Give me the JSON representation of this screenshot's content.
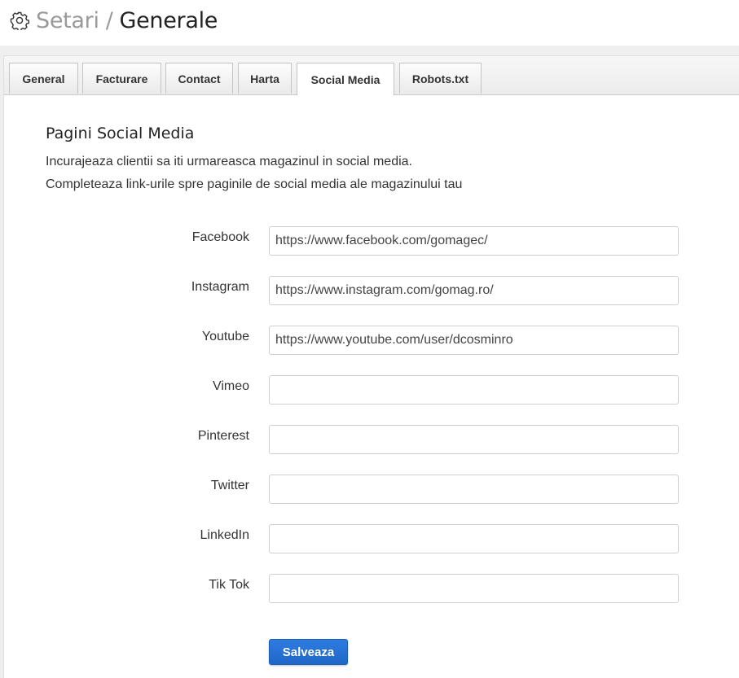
{
  "header": {
    "icon": "gear-icon",
    "breadcrumb_parent": "Setari",
    "breadcrumb_separator": "/",
    "breadcrumb_current": "Generale"
  },
  "tabs": [
    {
      "label": "General"
    },
    {
      "label": "Facturare"
    },
    {
      "label": "Contact"
    },
    {
      "label": "Harta"
    },
    {
      "label": "Social Media",
      "active": true
    },
    {
      "label": "Robots.txt"
    }
  ],
  "section": {
    "title": "Pagini Social Media",
    "description_line1": "Incurajeaza clientii sa iti urmareasca magazinul in social media.",
    "description_line2": "Completeaza link-urile spre paginile de social media ale magazinului tau"
  },
  "fields": [
    {
      "label": "Facebook",
      "value": "https://www.facebook.com/gomagec/"
    },
    {
      "label": "Instagram",
      "value": "https://www.instagram.com/gomag.ro/"
    },
    {
      "label": "Youtube",
      "value": "https://www.youtube.com/user/dcosminro"
    },
    {
      "label": "Vimeo",
      "value": ""
    },
    {
      "label": "Pinterest",
      "value": ""
    },
    {
      "label": "Twitter",
      "value": ""
    },
    {
      "label": "LinkedIn",
      "value": ""
    },
    {
      "label": "Tik Tok",
      "value": ""
    }
  ],
  "save_label": "Salveaza",
  "colors": {
    "primary_button": "#2f7be0",
    "title_muted": "#9a9a9a"
  }
}
